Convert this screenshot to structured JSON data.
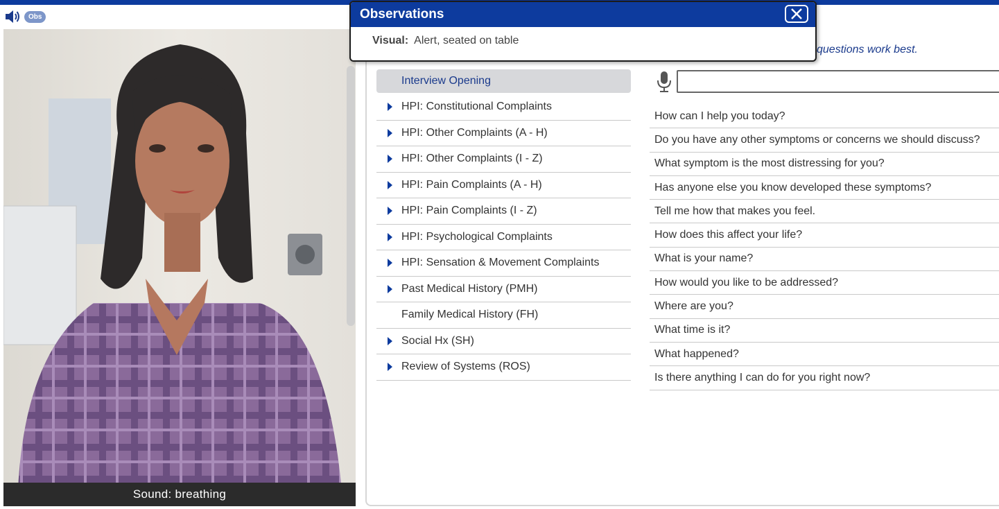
{
  "toolbar": {
    "obs_label": "Obs"
  },
  "caption": {
    "text": "Sound: breathing"
  },
  "hint": {
    "text": "questions work best."
  },
  "observations": {
    "title": "Observations",
    "visual_label": "Visual:",
    "visual_value": "Alert, seated on table"
  },
  "categories": [
    {
      "label": "Interview Opening",
      "arrow": false,
      "selected": true
    },
    {
      "label": "HPI: Constitutional Complaints",
      "arrow": true
    },
    {
      "label": "HPI: Other Complaints (A - H)",
      "arrow": true
    },
    {
      "label": "HPI: Other Complaints (I - Z)",
      "arrow": true
    },
    {
      "label": "HPI: Pain Complaints (A - H)",
      "arrow": true
    },
    {
      "label": "HPI: Pain Complaints (I - Z)",
      "arrow": true
    },
    {
      "label": "HPI: Psychological Complaints",
      "arrow": true
    },
    {
      "label": "HPI: Sensation & Movement Complaints",
      "arrow": true
    },
    {
      "label": "Past Medical History (PMH)",
      "arrow": true
    },
    {
      "label": "Family Medical History (FH)",
      "arrow": false
    },
    {
      "label": "Social Hx (SH)",
      "arrow": true
    },
    {
      "label": "Review of Systems (ROS)",
      "arrow": true
    }
  ],
  "question_input": {
    "value": ""
  },
  "questions": [
    "How can I help you today?",
    "Do you have any other symptoms or concerns we should discuss?",
    "What symptom is the most distressing for you?",
    "Has anyone else you know developed these symptoms?",
    "Tell me how that makes you feel.",
    "How does this affect your life?",
    "What is your name?",
    "How would you like to be addressed?",
    "Where are you?",
    "What time is it?",
    "What happened?",
    "Is there anything I can do for you right now?"
  ]
}
